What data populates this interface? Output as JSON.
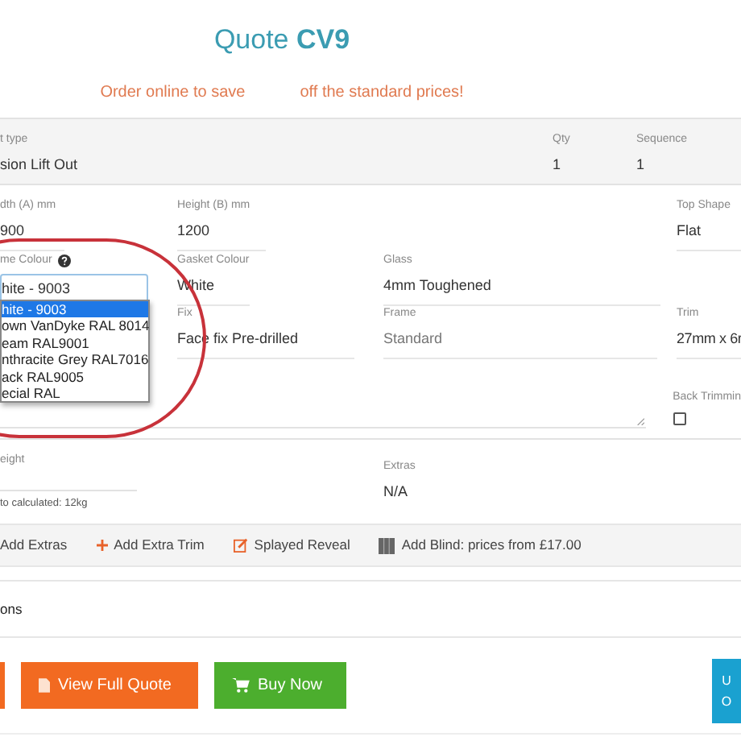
{
  "header": {
    "title": "Quote **CV9**",
    "promo": [
      "Order online to save",
      "off the standard prices!"
    ]
  },
  "product": {
    "type_label": "t type",
    "type_value": "sion Lift Out",
    "qty_label": "Qty",
    "qty": "1",
    "sequence_label": "Sequence",
    "sequence": "1"
  },
  "fields": {
    "width": {
      "label": "dth (A) mm",
      "value": "900"
    },
    "height": {
      "label": "Height (B) mm",
      "value": "1200"
    },
    "top_shape": {
      "label": "Top Shape",
      "value": "Flat"
    },
    "frame_colour": {
      "label": "me Colour",
      "value": "hite - 9003",
      "expanded": true,
      "options": [
        {
          "label": "hite - 9003",
          "selected": true
        },
        {
          "label": "own VanDyke RAL 8014",
          "selected": false
        },
        {
          "label": "eam RAL9001",
          "selected": false
        },
        {
          "label": "nthracite Grey RAL7016",
          "selected": false
        },
        {
          "label": "ack RAL9005",
          "selected": false
        },
        {
          "label": "ecial RAL",
          "selected": false
        }
      ]
    },
    "gasket_colour": {
      "label": "Gasket Colour",
      "value": "White"
    },
    "glass": {
      "label": "Glass",
      "value": "4mm Toughened"
    },
    "fix": {
      "label": "Fix",
      "value": "Face fix Pre-drilled"
    },
    "frame": {
      "label": "Frame",
      "value": "Standard",
      "disabled": true
    },
    "trim": {
      "label": "Trim",
      "value": "27mm x 6r"
    },
    "back_trimming": {
      "label": "Back Trimmin",
      "checked": false
    },
    "weight": {
      "label": "eight",
      "note": "to calculated: 12kg"
    },
    "extras": {
      "label": "Extras",
      "value": "N/A"
    }
  },
  "toolbar": [
    {
      "kind": "plain",
      "label": "Add Extras"
    },
    {
      "kind": "plus",
      "label": "Add Extra Trim"
    },
    {
      "kind": "edit",
      "label": "Splayed Reveal"
    },
    {
      "kind": "blind",
      "label": "Add Blind: prices from £17.00"
    }
  ],
  "section_title": "ons",
  "buttons": [
    {
      "kind": "orange-edge"
    },
    {
      "kind": "pdf",
      "label": "View Full Quote"
    },
    {
      "kind": "cart",
      "label": "Buy Now"
    },
    {
      "kind": "blue-edge",
      "lines": [
        "U",
        "O"
      ]
    }
  ]
}
